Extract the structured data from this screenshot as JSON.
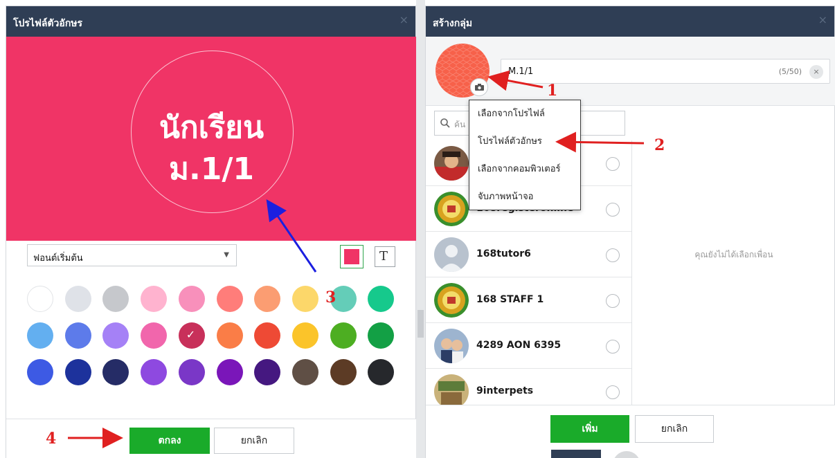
{
  "left_dialog": {
    "title": "โปรไฟล์ตัวอักษร",
    "close_glyph": "×",
    "preview_line1": "นักเรียน",
    "preview_line2": "ม.1/1",
    "preview_bg_color": "#f03466",
    "font_select_value": "ฟอนต์เริ่มต้น",
    "text_mode_glyph": "T",
    "ok_label": "ตกลง",
    "cancel_label": "ยกเลิก",
    "selected_swatch": "#c8305a",
    "swatches": [
      "#ffffff",
      "#dfe2e8",
      "#c6c8cc",
      "#ffb3cf",
      "#f890bb",
      "#ff7d7a",
      "#fb9d72",
      "#fcd76a",
      "#64cdb8",
      "#16c98c",
      "#63aff0",
      "#5d7bea",
      "#a581f6",
      "#f166ac",
      "#c8305a",
      "#fa7d47",
      "#ee4a35",
      "#fbc42a",
      "#4dae22",
      "#13a045",
      "#3d5ae4",
      "#1d329c",
      "#252c66",
      "#8e49e0",
      "#7a37c7",
      "#7a16b9",
      "#451880",
      "#5f4f45",
      "#5c3b25",
      "#26282c"
    ]
  },
  "right_dialog": {
    "title": "สร้างกลุ่ม",
    "close_glyph": "×",
    "group_name_value": "M.1/1",
    "group_name_count": "(5/50)",
    "clear_glyph": "×",
    "search_placeholder": "ค้น",
    "empty_selection_text": "คุณยังไม่ได้เลือกเพื่อน",
    "add_label": "เพิ่ม",
    "cancel_label": "ยกเลิก",
    "friends": [
      {
        "name": "",
        "avatar": "photo-red-shirt"
      },
      {
        "name": "168registeronline",
        "avatar": "school-logo"
      },
      {
        "name": "168tutor6",
        "avatar": "default-person"
      },
      {
        "name": "168 STAFF 1",
        "avatar": "school-logo"
      },
      {
        "name": "4289 AON 6395",
        "avatar": "photo-couple"
      },
      {
        "name": "9interpets",
        "avatar": "photo-shop"
      }
    ]
  },
  "photo_menu": {
    "items": [
      "เลือกจากโปรไฟล์",
      "โปรไฟล์ตัวอักษร",
      "เลือกจากคอมพิวเตอร์",
      "จับภาพหน้าจอ"
    ]
  },
  "annotations": {
    "num1": "1",
    "num2": "2",
    "num3": "3",
    "num4": "4",
    "red": "#e02020",
    "blue": "#1b1fe0"
  }
}
